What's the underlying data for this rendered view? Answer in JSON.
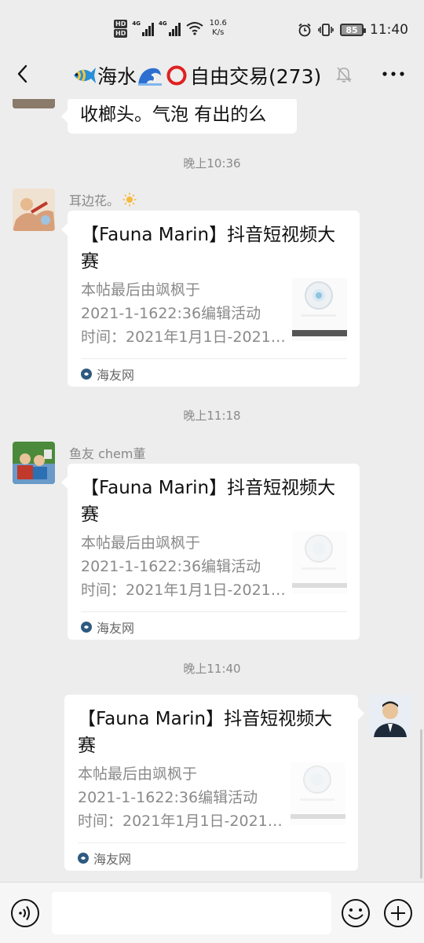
{
  "status_bar": {
    "hd1": "HD",
    "hd2": "HD",
    "net1": "4G",
    "net2": "4G",
    "speed_value": "10.6",
    "speed_unit": "K/s",
    "battery": "85",
    "time": "11:40"
  },
  "header": {
    "title_part1": "海水",
    "title_part2": "自由交易(273)"
  },
  "messages": {
    "m0": {
      "text": "收榔头。气泡 有出的么"
    },
    "t1": "晚上10:36",
    "m1": {
      "sender": "耳边花。",
      "title": "【Fauna Marin】抖音短视频大赛",
      "desc_line1": "本帖最后由飒枫于",
      "desc_line2": "2021-1-1622:36编辑活动",
      "desc_line3": "时间：2021年1月1日-2021年...",
      "source": "海友网"
    },
    "t2": "晚上11:18",
    "m2": {
      "sender": "鱼友 chem董",
      "title": "【Fauna Marin】抖音短视频大赛",
      "desc_line1": "本帖最后由飒枫于",
      "desc_line2": "2021-1-1622:36编辑活动",
      "desc_line3": "时间：2021年1月1日-2021年...",
      "source": "海友网"
    },
    "t3": "晚上11:40",
    "m3": {
      "title": "【Fauna Marin】抖音短视频大赛",
      "desc_line1": "本帖最后由飒枫于",
      "desc_line2": "2021-1-1622:36编辑活动",
      "desc_line3": "时间：2021年1月1日-2021年...",
      "source": "海友网"
    }
  },
  "input": {
    "value": ""
  },
  "colors": {
    "background": "#ededed",
    "bubble": "#ffffff",
    "timestamp": "#8a8a8a",
    "source_icon": "#2f5a80"
  },
  "icons": {
    "back": "back-arrow-icon",
    "mute": "bell-mute-icon",
    "more": "more-dots-icon",
    "voice": "voice-icon",
    "emoji": "emoji-icon",
    "plus": "plus-icon"
  }
}
